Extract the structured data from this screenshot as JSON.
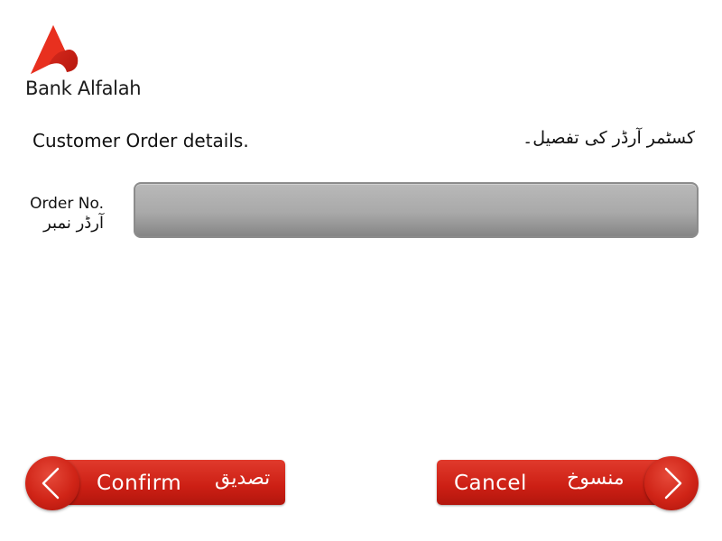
{
  "brand": {
    "name": "Bank Alfalah",
    "logo_icon": "bank-alfalah-logo-icon",
    "accent_color": "#d32215"
  },
  "heading": {
    "english": "Customer Order details.",
    "urdu": "کسٹمر آرڈر کی تفصیل۔"
  },
  "order_field": {
    "label_en": "Order No.",
    "label_ur": "آرڈر نمبر",
    "value": ""
  },
  "buttons": {
    "confirm": {
      "label_en": "Confirm",
      "label_ur": "تصدیق",
      "icon": "chevron-left-icon"
    },
    "cancel": {
      "label_en": "Cancel",
      "label_ur": "منسوخ",
      "icon": "chevron-right-icon"
    }
  }
}
